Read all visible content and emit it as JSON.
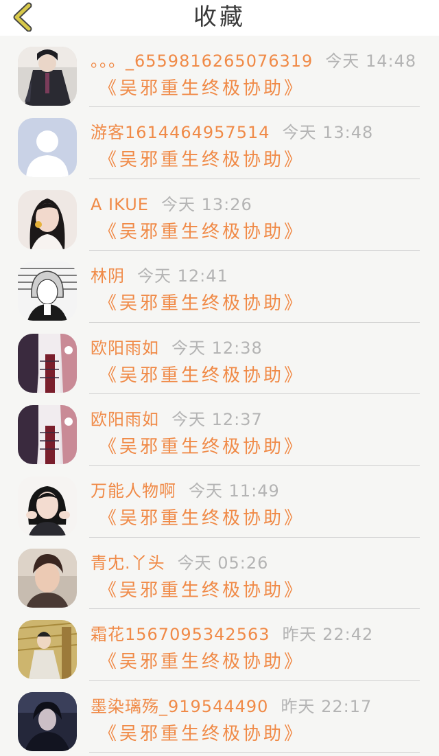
{
  "header": {
    "title": "收藏"
  },
  "items": [
    {
      "name": "。。。_6559816265076319",
      "time": "今天 14:48",
      "subject": "《吴邪重生终极协助》",
      "avatar": "avatar-dark-costume"
    },
    {
      "name": "游客1614464957514",
      "time": "今天 13:48",
      "subject": "《吴邪重生终极协助》",
      "avatar": "default-person-avatar"
    },
    {
      "name": "A IKUE",
      "time": "今天 13:26",
      "subject": "《吴邪重生终极协助》",
      "avatar": "avatar-woman-photo"
    },
    {
      "name": "林阴",
      "time": "今天 12:41",
      "subject": "《吴邪重生终极协助》",
      "avatar": "avatar-anime-sketch"
    },
    {
      "name": "欧阳雨如",
      "time": "今天 12:38",
      "subject": "《吴邪重生终极协助》",
      "avatar": "avatar-hanfu"
    },
    {
      "name": "欧阳雨如",
      "time": "今天 12:37",
      "subject": "《吴邪重生终极协助》",
      "avatar": "avatar-hanfu"
    },
    {
      "name": "万能人物啊",
      "time": "今天 11:49",
      "subject": "《吴邪重生终极协助》",
      "avatar": "avatar-girl-photo"
    },
    {
      "name": "青冘.丫头",
      "time": "今天 05:26",
      "subject": "《吴邪重生终极协助》",
      "avatar": "avatar-man-photo"
    },
    {
      "name": "霜花1567095342563",
      "time": "昨天 22:42",
      "subject": "《吴邪重生终极协助》",
      "avatar": "avatar-drama-still"
    },
    {
      "name": "墨染璃殇_919544490",
      "time": "昨天 22:17",
      "subject": "《吴邪重生终极协助》",
      "avatar": "avatar-dark-figure"
    }
  ],
  "colors": {
    "accent": "#f08a47",
    "time": "#b4b4b4",
    "back_arrow": "#d8c94a"
  }
}
